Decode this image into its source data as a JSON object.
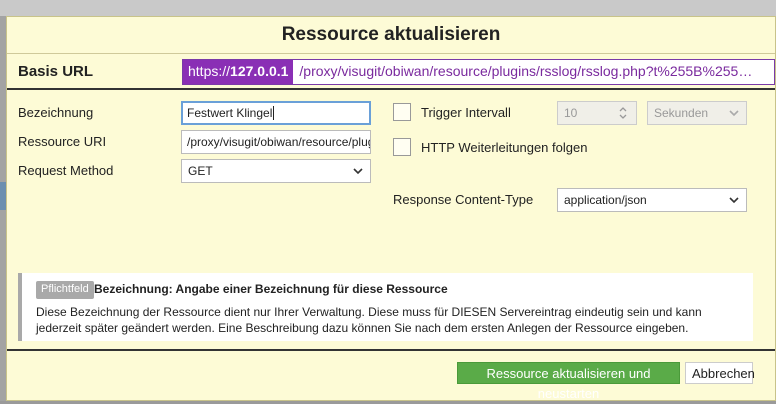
{
  "dialog": {
    "title": "Ressource aktualisieren"
  },
  "base_url": {
    "label": "Basis URL",
    "protocol": "https://",
    "host": "127.0.0.1",
    "path": "/proxy/visugit/obiwan/resource/plugins/rsslog/rsslog.php?t%255B%255…"
  },
  "form": {
    "name_label": "Bezeichnung",
    "name_value": "Festwert Klingel",
    "uri_label": "Ressource URI",
    "uri_value": "/proxy/visugit/obiwan/resource/plugins",
    "method_label": "Request Method",
    "method_value": "GET",
    "trigger_label": "Trigger Intervall",
    "trigger_value": "10",
    "trigger_unit": "Sekunden",
    "redirect_label": "HTTP Weiterleitungen folgen",
    "content_type_label": "Response Content-Type",
    "content_type_value": "application/json"
  },
  "info": {
    "badge": "Pflichtfeld",
    "title": "Bezeichnung: Angabe einer Bezeichnung für diese Ressource",
    "text": "Diese Bezeichnung der Ressource dient nur Ihrer Verwaltung. Diese muss für DIESEN Servereintrag eindeutig sein und kann jederzeit später geändert werden. Eine Beschreibung dazu können Sie nach dem ersten Anlegen der Ressource eingeben."
  },
  "footer": {
    "submit_label": "Ressource aktualisieren und neustarten",
    "cancel_label": "Abbrechen"
  },
  "colors": {
    "dialog_bg": "#fdfbd6",
    "accent_purple": "#8a2fb5",
    "primary_green": "#5aab48"
  }
}
